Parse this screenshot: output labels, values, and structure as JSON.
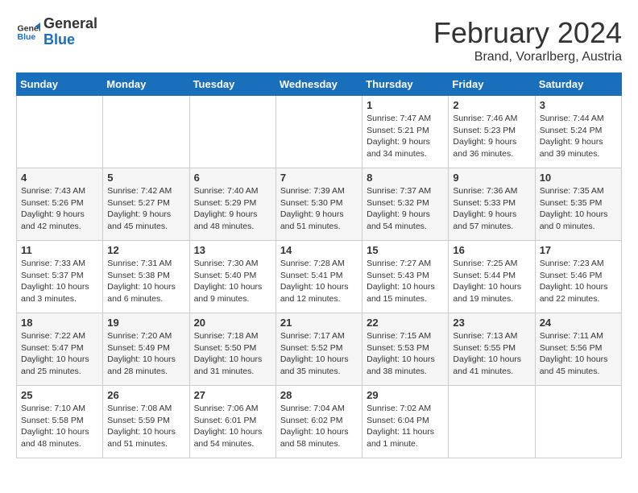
{
  "logo": {
    "line1": "General",
    "line2": "Blue"
  },
  "title": "February 2024",
  "subtitle": "Brand, Vorarlberg, Austria",
  "weekdays": [
    "Sunday",
    "Monday",
    "Tuesday",
    "Wednesday",
    "Thursday",
    "Friday",
    "Saturday"
  ],
  "weeks": [
    [
      {
        "day": "",
        "info": ""
      },
      {
        "day": "",
        "info": ""
      },
      {
        "day": "",
        "info": ""
      },
      {
        "day": "",
        "info": ""
      },
      {
        "day": "1",
        "info": "Sunrise: 7:47 AM\nSunset: 5:21 PM\nDaylight: 9 hours\nand 34 minutes."
      },
      {
        "day": "2",
        "info": "Sunrise: 7:46 AM\nSunset: 5:23 PM\nDaylight: 9 hours\nand 36 minutes."
      },
      {
        "day": "3",
        "info": "Sunrise: 7:44 AM\nSunset: 5:24 PM\nDaylight: 9 hours\nand 39 minutes."
      }
    ],
    [
      {
        "day": "4",
        "info": "Sunrise: 7:43 AM\nSunset: 5:26 PM\nDaylight: 9 hours\nand 42 minutes."
      },
      {
        "day": "5",
        "info": "Sunrise: 7:42 AM\nSunset: 5:27 PM\nDaylight: 9 hours\nand 45 minutes."
      },
      {
        "day": "6",
        "info": "Sunrise: 7:40 AM\nSunset: 5:29 PM\nDaylight: 9 hours\nand 48 minutes."
      },
      {
        "day": "7",
        "info": "Sunrise: 7:39 AM\nSunset: 5:30 PM\nDaylight: 9 hours\nand 51 minutes."
      },
      {
        "day": "8",
        "info": "Sunrise: 7:37 AM\nSunset: 5:32 PM\nDaylight: 9 hours\nand 54 minutes."
      },
      {
        "day": "9",
        "info": "Sunrise: 7:36 AM\nSunset: 5:33 PM\nDaylight: 9 hours\nand 57 minutes."
      },
      {
        "day": "10",
        "info": "Sunrise: 7:35 AM\nSunset: 5:35 PM\nDaylight: 10 hours\nand 0 minutes."
      }
    ],
    [
      {
        "day": "11",
        "info": "Sunrise: 7:33 AM\nSunset: 5:37 PM\nDaylight: 10 hours\nand 3 minutes."
      },
      {
        "day": "12",
        "info": "Sunrise: 7:31 AM\nSunset: 5:38 PM\nDaylight: 10 hours\nand 6 minutes."
      },
      {
        "day": "13",
        "info": "Sunrise: 7:30 AM\nSunset: 5:40 PM\nDaylight: 10 hours\nand 9 minutes."
      },
      {
        "day": "14",
        "info": "Sunrise: 7:28 AM\nSunset: 5:41 PM\nDaylight: 10 hours\nand 12 minutes."
      },
      {
        "day": "15",
        "info": "Sunrise: 7:27 AM\nSunset: 5:43 PM\nDaylight: 10 hours\nand 15 minutes."
      },
      {
        "day": "16",
        "info": "Sunrise: 7:25 AM\nSunset: 5:44 PM\nDaylight: 10 hours\nand 19 minutes."
      },
      {
        "day": "17",
        "info": "Sunrise: 7:23 AM\nSunset: 5:46 PM\nDaylight: 10 hours\nand 22 minutes."
      }
    ],
    [
      {
        "day": "18",
        "info": "Sunrise: 7:22 AM\nSunset: 5:47 PM\nDaylight: 10 hours\nand 25 minutes."
      },
      {
        "day": "19",
        "info": "Sunrise: 7:20 AM\nSunset: 5:49 PM\nDaylight: 10 hours\nand 28 minutes."
      },
      {
        "day": "20",
        "info": "Sunrise: 7:18 AM\nSunset: 5:50 PM\nDaylight: 10 hours\nand 31 minutes."
      },
      {
        "day": "21",
        "info": "Sunrise: 7:17 AM\nSunset: 5:52 PM\nDaylight: 10 hours\nand 35 minutes."
      },
      {
        "day": "22",
        "info": "Sunrise: 7:15 AM\nSunset: 5:53 PM\nDaylight: 10 hours\nand 38 minutes."
      },
      {
        "day": "23",
        "info": "Sunrise: 7:13 AM\nSunset: 5:55 PM\nDaylight: 10 hours\nand 41 minutes."
      },
      {
        "day": "24",
        "info": "Sunrise: 7:11 AM\nSunset: 5:56 PM\nDaylight: 10 hours\nand 45 minutes."
      }
    ],
    [
      {
        "day": "25",
        "info": "Sunrise: 7:10 AM\nSunset: 5:58 PM\nDaylight: 10 hours\nand 48 minutes."
      },
      {
        "day": "26",
        "info": "Sunrise: 7:08 AM\nSunset: 5:59 PM\nDaylight: 10 hours\nand 51 minutes."
      },
      {
        "day": "27",
        "info": "Sunrise: 7:06 AM\nSunset: 6:01 PM\nDaylight: 10 hours\nand 54 minutes."
      },
      {
        "day": "28",
        "info": "Sunrise: 7:04 AM\nSunset: 6:02 PM\nDaylight: 10 hours\nand 58 minutes."
      },
      {
        "day": "29",
        "info": "Sunrise: 7:02 AM\nSunset: 6:04 PM\nDaylight: 11 hours\nand 1 minute."
      },
      {
        "day": "",
        "info": ""
      },
      {
        "day": "",
        "info": ""
      }
    ]
  ]
}
